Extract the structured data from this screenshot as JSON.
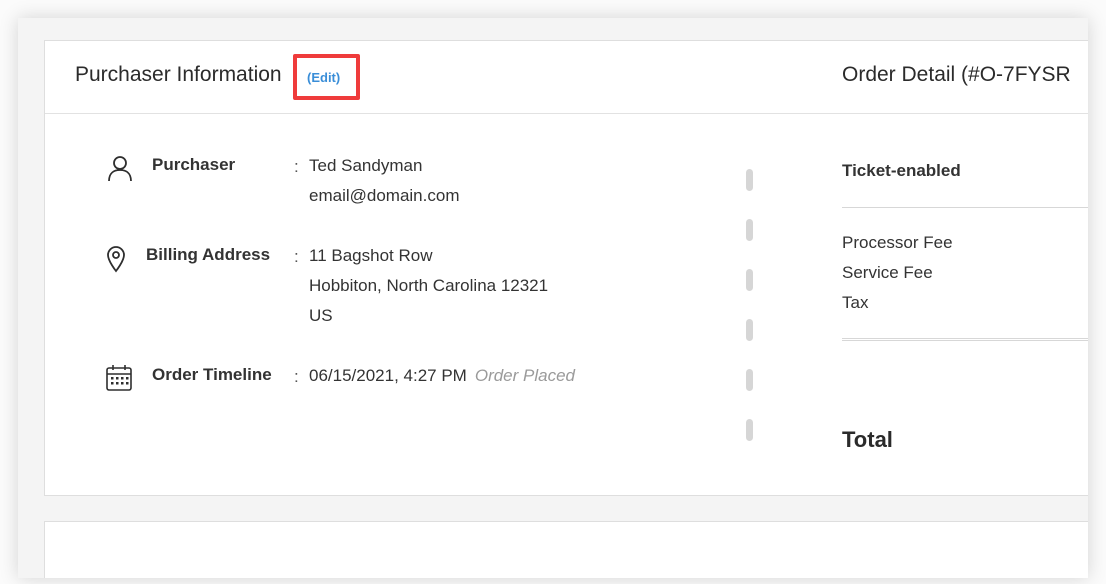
{
  "purchaser_section": {
    "title": "Purchaser Information",
    "edit_label": "(Edit)",
    "purchaser": {
      "label": "Purchaser",
      "name": "Ted Sandyman",
      "email": "email@domain.com",
      "icon": "person-icon"
    },
    "billing": {
      "label": "Billing Address",
      "line1": "11 Bagshot Row",
      "line2": "Hobbiton, North Carolina 12321",
      "line3": "US",
      "icon": "location-pin-icon"
    },
    "timeline": {
      "label": "Order Timeline",
      "datetime": "06/15/2021, 4:27 PM",
      "status": "Order Placed",
      "icon": "calendar-icon"
    },
    "separator": ":"
  },
  "order_detail": {
    "title": "Order Detail (#O-7FYSR",
    "ticket_label": "Ticket-enabled",
    "fees": [
      "Processor Fee",
      "Service Fee",
      "Tax"
    ],
    "total_label": "Total"
  },
  "colors": {
    "edit_link": "#3a8ed8",
    "highlight_border": "#ef3b3b"
  }
}
